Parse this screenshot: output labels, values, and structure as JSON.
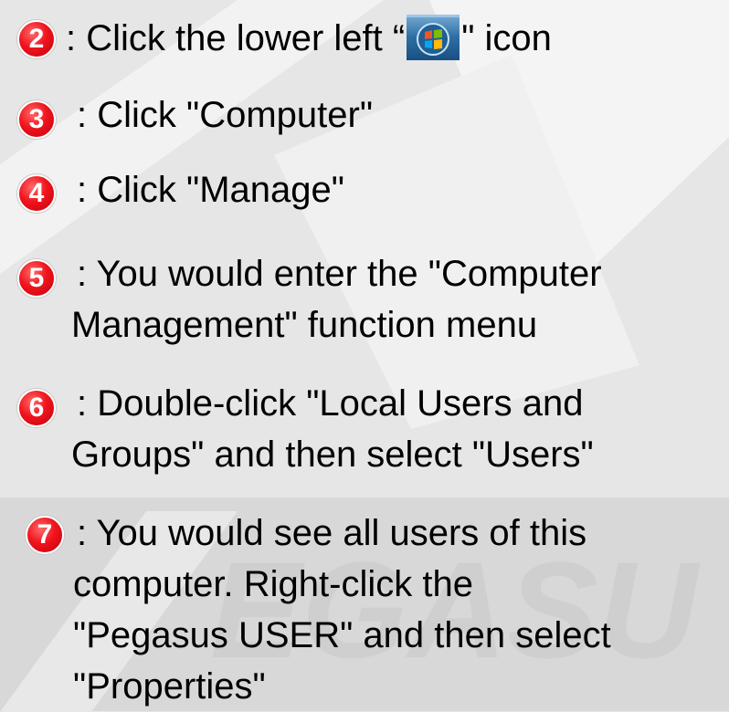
{
  "steps": [
    {
      "number": "2",
      "lines": [
        ": Click the lower left “",
        "\" icon"
      ]
    },
    {
      "number": "3",
      "lines": [
        ": Click \"Computer\""
      ]
    },
    {
      "number": "4",
      "lines": [
        ": Click \"Manage\""
      ]
    },
    {
      "number": "5",
      "lines": [
        ": You would enter the \"Computer",
        "Management\" function menu"
      ]
    },
    {
      "number": "6",
      "lines": [
        ": Double-click \"Local Users and",
        "Groups\" and then select \"Users\""
      ]
    },
    {
      "number": "7",
      "lines": [
        ": You would see all users of this",
        "computer. Right-click the",
        "\"Pegasus USER\" and then select",
        "\"Properties\""
      ]
    }
  ],
  "icons": {
    "start": "windows-start-orb-icon",
    "watermark": "pegasus-watermark"
  },
  "colors": {
    "badge": "#f0141e",
    "background": "#e6e6e6",
    "text": "#000000"
  }
}
